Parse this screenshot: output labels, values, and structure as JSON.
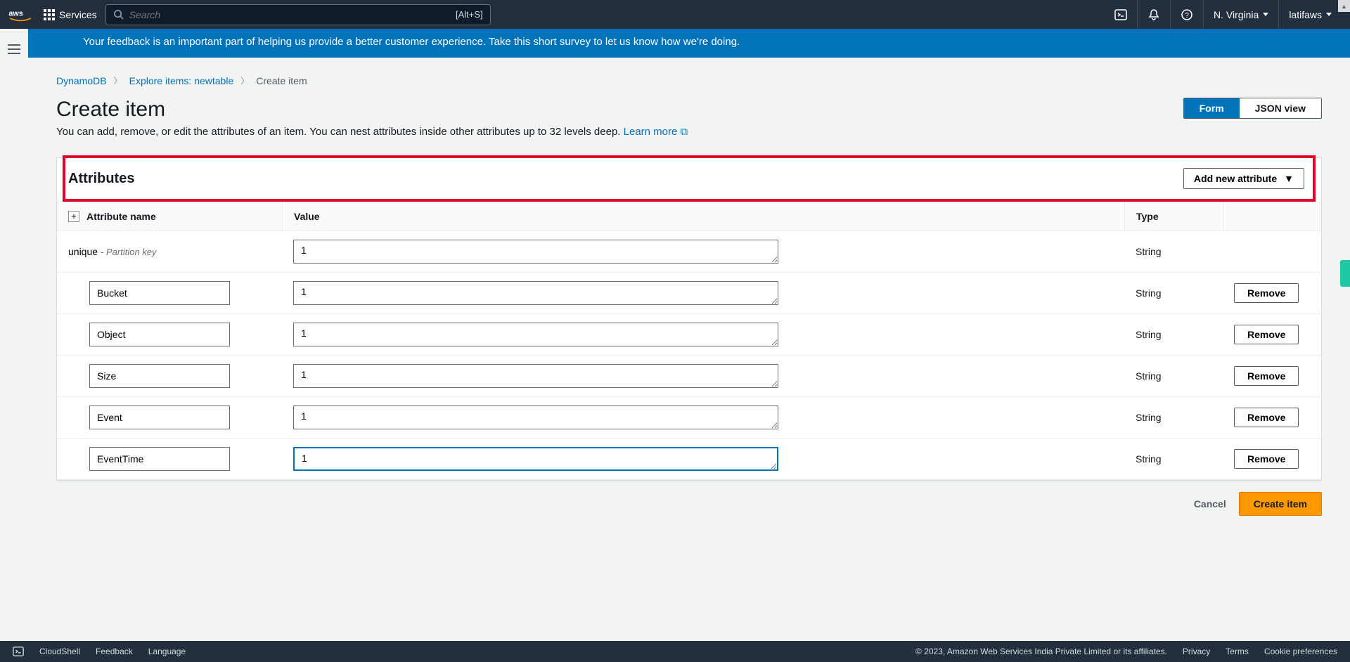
{
  "topnav": {
    "services_label": "Services",
    "search_placeholder": "Search",
    "search_hint": "[Alt+S]",
    "region": "N. Virginia",
    "account": "latifaws"
  },
  "banner": {
    "text": "Your feedback is an important part of helping us provide a better customer experience. Take this short survey to let us know how we're doing."
  },
  "breadcrumb": {
    "items": [
      "DynamoDB",
      "Explore items: newtable",
      "Create item"
    ]
  },
  "page": {
    "title": "Create item",
    "subtext": "You can add, remove, or edit the attributes of an item. You can nest attributes inside other attributes up to 32 levels deep.",
    "learn_more": "Learn more",
    "toggle_form": "Form",
    "toggle_json": "JSON view"
  },
  "attributes_panel": {
    "heading": "Attributes",
    "add_button": "Add new attribute",
    "columns": {
      "name": "Attribute name",
      "value": "Value",
      "type": "Type"
    },
    "remove_label": "Remove",
    "rows": [
      {
        "name": "unique",
        "pk_label": "- Partition key",
        "editable_name": false,
        "value": "1",
        "type": "String",
        "removable": false,
        "focused": false
      },
      {
        "name": "Bucket",
        "editable_name": true,
        "value": "1",
        "type": "String",
        "removable": true,
        "focused": false
      },
      {
        "name": "Object",
        "editable_name": true,
        "value": "1",
        "type": "String",
        "removable": true,
        "focused": false
      },
      {
        "name": "Size",
        "editable_name": true,
        "value": "1",
        "type": "String",
        "removable": true,
        "focused": false
      },
      {
        "name": "Event",
        "editable_name": true,
        "value": "1",
        "type": "String",
        "removable": true,
        "focused": false
      },
      {
        "name": "EventTime",
        "editable_name": true,
        "value": "1",
        "type": "String",
        "removable": true,
        "focused": true
      }
    ]
  },
  "actions": {
    "cancel": "Cancel",
    "create": "Create item"
  },
  "footer": {
    "cloudshell": "CloudShell",
    "feedback": "Feedback",
    "language": "Language",
    "copyright": "© 2023, Amazon Web Services India Private Limited or its affiliates.",
    "privacy": "Privacy",
    "terms": "Terms",
    "cookie": "Cookie preferences"
  }
}
